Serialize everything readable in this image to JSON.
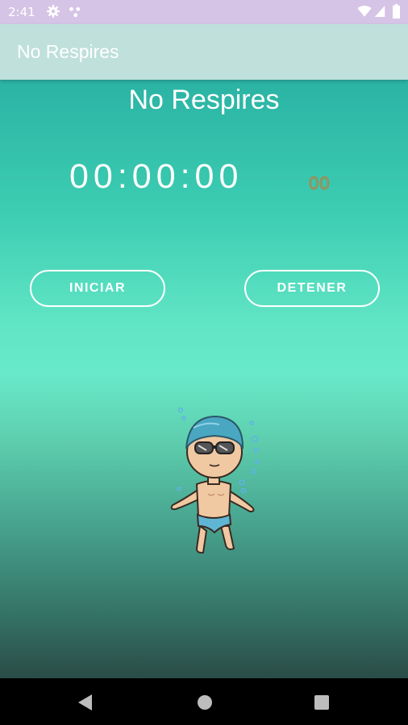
{
  "status_bar": {
    "time": "2:41",
    "icons": [
      "gear-icon",
      "dots-icon",
      "wifi-icon",
      "signal-icon",
      "battery-icon"
    ]
  },
  "app_bar": {
    "title": "No Respires"
  },
  "screen": {
    "title": "No Respires",
    "timer": "00:00:00",
    "centiseconds": "00"
  },
  "buttons": {
    "start_label": "INICIAR",
    "stop_label": "DETENER"
  },
  "navigation": {
    "icons": [
      "back-icon",
      "home-icon",
      "recents-icon"
    ]
  },
  "colors": {
    "status_bar": "#d6c4e6",
    "app_bar": "#bfe0db",
    "gradient_top": "#2bb3a4",
    "gradient_mid": "#68eaca",
    "gradient_bottom": "#2a4c46",
    "centiseconds": "#c07a36"
  }
}
